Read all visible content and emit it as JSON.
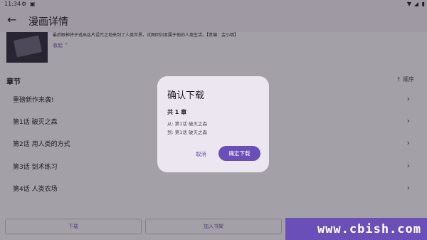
{
  "status": {
    "time": "11:34"
  },
  "appbar": {
    "title": "漫画详情"
  },
  "detail": {
    "description": "最后眼神将于逃出这片诅咒之地来到了人类世界，试图回归本属于他的人类生活。【责编：金小明】",
    "collapse_label": "收起 ^"
  },
  "chapters": {
    "section_title": "章节",
    "order_label": "↑ 顺序",
    "items": [
      {
        "label": "重磅新作来袭!"
      },
      {
        "label": "第1话 破灭之森"
      },
      {
        "label": "第2话 用人类的方式"
      },
      {
        "label": "第3话 剑术练习"
      },
      {
        "label": "第4话 人类农场"
      }
    ]
  },
  "bottom_bar": {
    "download": "下载",
    "add_shelf": "加入书架"
  },
  "dialog": {
    "title": "确认下载",
    "count": "共 1 章",
    "from": "从: 第1话 破灭之森",
    "to": "到: 第1话 破灭之森",
    "cancel": "取消",
    "confirm": "确定下载"
  },
  "watermark": {
    "text": "www.cbish.com"
  },
  "colors": {
    "accent": "#6b4fb8",
    "dialog_bg": "#ece6f0",
    "scrim": "#262230"
  }
}
